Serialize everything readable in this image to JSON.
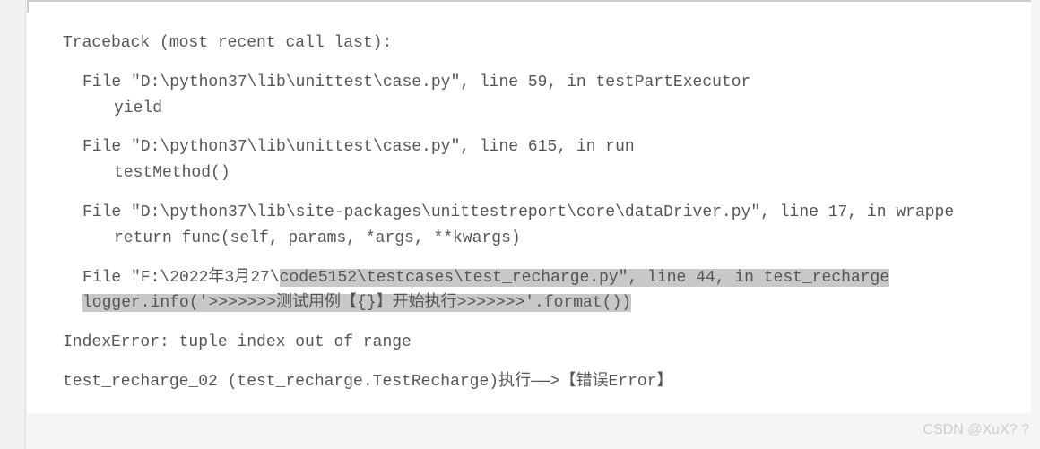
{
  "traceback": {
    "header": "Traceback (most recent call last):",
    "frames": [
      {
        "file_prefix": "  File \"D:\\python37\\lib\\unittest\\case.py\", line 59, in testPartExecutor",
        "code": "    yield"
      },
      {
        "file_prefix": "  File \"D:\\python37\\lib\\unittest\\case.py\", line 615, in run",
        "code": "    testMethod()"
      },
      {
        "file_prefix": "  File \"D:\\python37\\lib\\site-packages\\unittestreport\\core\\dataDriver.py\", line 17, in wrappe",
        "code": "    return func(self, params, *args, **kwargs)"
      },
      {
        "file_prefix_a": "  File \"F:\\2022年3月27\\",
        "file_prefix_b": "code5152\\testcases\\test_recharge.py\", line 44, in test_recharge",
        "code": "    logger.info('>>>>>>>测试用例【{}】开始执行>>>>>>>'.format())"
      }
    ],
    "error": "IndexError: tuple index out of range",
    "test_result": "test_recharge_02 (test_recharge.TestRecharge)执行——>【错误Error】"
  },
  "watermark": "CSDN @XuX? ?"
}
